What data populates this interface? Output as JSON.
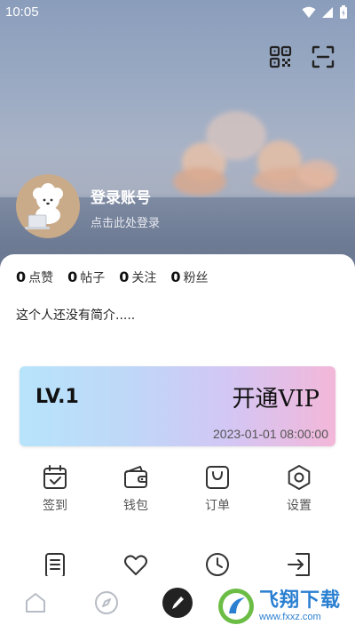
{
  "status_bar": {
    "time": "10:05"
  },
  "header": {
    "login_title": "登录账号",
    "login_subtitle": "点击此处登录"
  },
  "stats": [
    {
      "value": "0",
      "label": "点赞"
    },
    {
      "value": "0",
      "label": "帖子"
    },
    {
      "value": "0",
      "label": "关注"
    },
    {
      "value": "0",
      "label": "粉丝"
    }
  ],
  "bio": "这个人还没有简介.....",
  "vip": {
    "level": "LV.1",
    "open_label": "开通VIP",
    "date": "2023-01-01 08:00:00"
  },
  "grid": [
    {
      "label": "签到",
      "icon": "calendar-check-icon"
    },
    {
      "label": "钱包",
      "icon": "wallet-icon"
    },
    {
      "label": "订单",
      "icon": "shopping-bag-icon"
    },
    {
      "label": "设置",
      "icon": "hexagon-settings-icon"
    }
  ],
  "grid_row2": [
    {
      "icon": "note-icon"
    },
    {
      "icon": "heart-icon"
    },
    {
      "icon": "clock-icon"
    },
    {
      "icon": "logout-icon"
    }
  ],
  "bottom_nav": [
    {
      "icon": "home-icon"
    },
    {
      "icon": "compass-icon"
    },
    {
      "icon": "pen-icon"
    }
  ],
  "watermark": {
    "text": "飞翔下载",
    "url": "www.fxxz.com"
  }
}
